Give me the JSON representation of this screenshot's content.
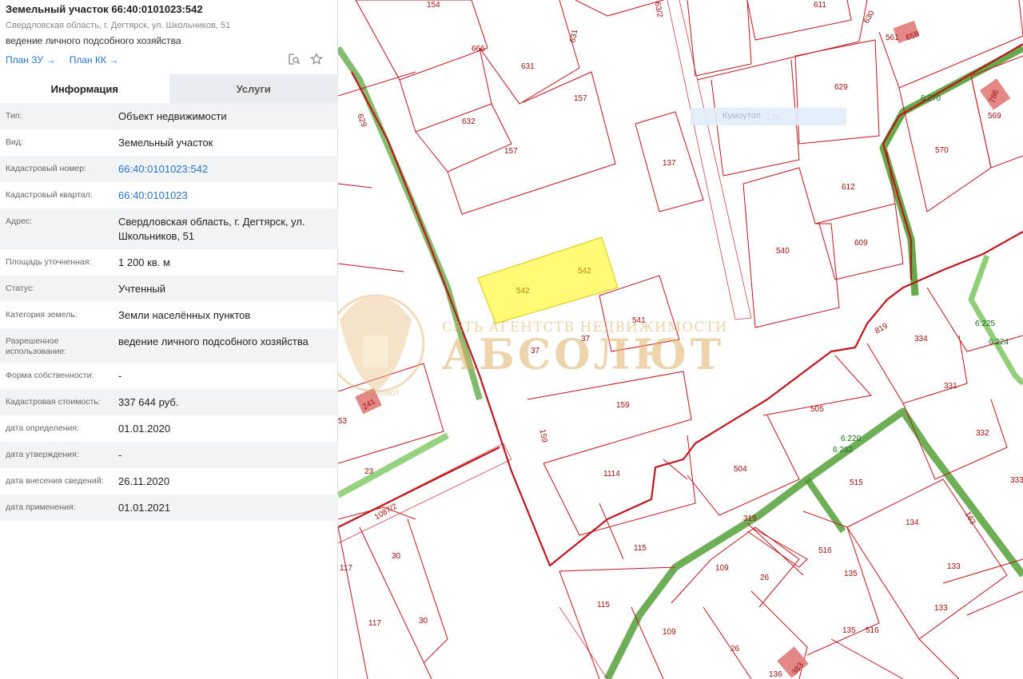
{
  "header": {
    "title": "Земельный участок 66:40:0101023:542",
    "address": "Свердловская область, г. Дегтярск, ул. Школьников, 51",
    "usage": "ведение личного подсобного хозяйства",
    "link_zu": "План ЗУ →",
    "link_kk": "План КК →"
  },
  "icons": {
    "search": "search-document-icon",
    "star": "star-icon"
  },
  "tabs": [
    {
      "label": "Информация",
      "active": true
    },
    {
      "label": "Услуги",
      "active": false
    }
  ],
  "rows": [
    {
      "label": "Тип:",
      "value": "Объект недвижимости"
    },
    {
      "label": "Вид:",
      "value": "Земельный участок"
    },
    {
      "label": "Кадастровый номер:",
      "value": "66:40:0101023:542"
    },
    {
      "label": "Кадастровый квартал:",
      "value": "66:40:0101023"
    },
    {
      "label": "Адрес:",
      "value": "Свердловская область, г. Дегтярск, ул. Школьников, 51"
    },
    {
      "label": "Площадь уточненная:",
      "value": "1 200 кв. м"
    },
    {
      "label": "Статус:",
      "value": "Учтенный"
    },
    {
      "label": "Категория земель:",
      "value": "Земли населённых пунктов"
    },
    {
      "label": "Разрешенное использование:",
      "value": "ведение личного подсобного хозяйства"
    },
    {
      "label": "Форма собственности:",
      "value": "-"
    },
    {
      "label": "Кадастровая стоимость:",
      "value": "337 644 руб."
    },
    {
      "label": "дата определения:",
      "value": "01.01.2020"
    },
    {
      "label": "дата утверждения:",
      "value": "-"
    },
    {
      "label": "дата внесения сведений:",
      "value": "26.11.2020"
    },
    {
      "label": "дата применения:",
      "value": "01.01.2021"
    }
  ],
  "map": {
    "watermark_line1": "СЕТЬ АГЕНТСТВ НЕДВИЖИМОСТИ",
    "watermark_line2": "АБСОЛЮТ",
    "watermark_small": "АБСОЛЮТ",
    "faded_label": "Кумоутоп",
    "colors": {
      "parcel_line": "#c0141e",
      "selected_fill": "#fffb6e",
      "green_line": "#5aa63c",
      "building_fill": "#e07a7a"
    },
    "labels": [
      "154",
      "666",
      "631",
      "631",
      "632",
      "157",
      "157",
      "611",
      "630",
      "561",
      "658",
      "629",
      "136",
      "6:270",
      "786",
      "569",
      "570",
      "137",
      "612",
      "540",
      "609",
      "542",
      "542",
      "541",
      "37",
      "37",
      "819",
      "334",
      "6:225",
      "6:224",
      "331",
      "159",
      "159",
      "505",
      "332",
      "333",
      "6:220",
      "6:262",
      "504",
      "515",
      "134",
      "1114",
      "319",
      "163",
      "115",
      "516",
      "109",
      "26",
      "135",
      "133",
      "133",
      "115",
      "109",
      "26",
      "135",
      "516",
      "136",
      "383",
      "117",
      "30",
      "117",
      "30",
      "23",
      "53",
      "241",
      "1087/2",
      "63/2",
      "629"
    ]
  }
}
